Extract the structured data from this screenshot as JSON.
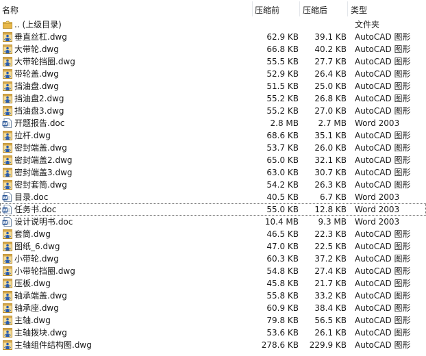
{
  "columns": {
    "name": "名称",
    "size": "压缩前",
    "packed": "压缩后",
    "type": "类型"
  },
  "parent": {
    "name": ".. (上级目录)",
    "type": "文件夹",
    "icon": "folder-icon"
  },
  "files": [
    {
      "name": "垂直丝杠.dwg",
      "size": "62.9 KB",
      "packed": "39.1 KB",
      "type": "AutoCAD 图形",
      "icon": "dwg-file-icon"
    },
    {
      "name": "大带轮.dwg",
      "size": "66.8 KB",
      "packed": "40.2 KB",
      "type": "AutoCAD 图形",
      "icon": "dwg-file-icon"
    },
    {
      "name": "大带轮挡圈.dwg",
      "size": "55.5 KB",
      "packed": "27.7 KB",
      "type": "AutoCAD 图形",
      "icon": "dwg-file-icon"
    },
    {
      "name": "带轮盖.dwg",
      "size": "52.9 KB",
      "packed": "26.4 KB",
      "type": "AutoCAD 图形",
      "icon": "dwg-file-icon"
    },
    {
      "name": "挡油盘.dwg",
      "size": "51.5 KB",
      "packed": "25.0 KB",
      "type": "AutoCAD 图形",
      "icon": "dwg-file-icon"
    },
    {
      "name": "挡油盘2.dwg",
      "size": "55.2 KB",
      "packed": "26.8 KB",
      "type": "AutoCAD 图形",
      "icon": "dwg-file-icon"
    },
    {
      "name": "挡油盘3.dwg",
      "size": "55.2 KB",
      "packed": "27.0 KB",
      "type": "AutoCAD 图形",
      "icon": "dwg-file-icon"
    },
    {
      "name": "开题报告.doc",
      "size": "2.8 MB",
      "packed": "2.7 MB",
      "type": "Word 2003",
      "icon": "word-file-icon"
    },
    {
      "name": "拉杆.dwg",
      "size": "68.6 KB",
      "packed": "35.1 KB",
      "type": "AutoCAD 图形",
      "icon": "dwg-file-icon"
    },
    {
      "name": "密封端盖.dwg",
      "size": "53.7 KB",
      "packed": "26.0 KB",
      "type": "AutoCAD 图形",
      "icon": "dwg-file-icon"
    },
    {
      "name": "密封端盖2.dwg",
      "size": "65.0 KB",
      "packed": "32.1 KB",
      "type": "AutoCAD 图形",
      "icon": "dwg-file-icon"
    },
    {
      "name": "密封端盖3.dwg",
      "size": "63.0 KB",
      "packed": "30.7 KB",
      "type": "AutoCAD 图形",
      "icon": "dwg-file-icon"
    },
    {
      "name": "密封套筒.dwg",
      "size": "54.2 KB",
      "packed": "26.3 KB",
      "type": "AutoCAD 图形",
      "icon": "dwg-file-icon"
    },
    {
      "name": "目录.doc",
      "size": "40.5 KB",
      "packed": "6.7 KB",
      "type": "Word 2003",
      "icon": "word-file-icon"
    },
    {
      "name": "任务书.doc",
      "size": "55.0 KB",
      "packed": "12.8 KB",
      "type": "Word 2003",
      "icon": "word-file-icon",
      "selected": true
    },
    {
      "name": "设计说明书.doc",
      "size": "10.4 MB",
      "packed": "9.3 MB",
      "type": "Word 2003",
      "icon": "word-file-icon"
    },
    {
      "name": "套筒.dwg",
      "size": "46.5 KB",
      "packed": "22.3 KB",
      "type": "AutoCAD 图形",
      "icon": "dwg-file-icon"
    },
    {
      "name": "图纸_6.dwg",
      "size": "47.0 KB",
      "packed": "22.5 KB",
      "type": "AutoCAD 图形",
      "icon": "dwg-file-icon"
    },
    {
      "name": "小带轮.dwg",
      "size": "60.3 KB",
      "packed": "37.2 KB",
      "type": "AutoCAD 图形",
      "icon": "dwg-file-icon"
    },
    {
      "name": "小带轮挡圈.dwg",
      "size": "54.8 KB",
      "packed": "27.4 KB",
      "type": "AutoCAD 图形",
      "icon": "dwg-file-icon"
    },
    {
      "name": "压板.dwg",
      "size": "45.8 KB",
      "packed": "21.7 KB",
      "type": "AutoCAD 图形",
      "icon": "dwg-file-icon"
    },
    {
      "name": "轴承端盖.dwg",
      "size": "55.8 KB",
      "packed": "33.2 KB",
      "type": "AutoCAD 图形",
      "icon": "dwg-file-icon"
    },
    {
      "name": "轴承座.dwg",
      "size": "60.9 KB",
      "packed": "38.4 KB",
      "type": "AutoCAD 图形",
      "icon": "dwg-file-icon"
    },
    {
      "name": "主轴.dwg",
      "size": "79.8 KB",
      "packed": "56.5 KB",
      "type": "AutoCAD 图形",
      "icon": "dwg-file-icon"
    },
    {
      "name": "主轴拨块.dwg",
      "size": "53.6 KB",
      "packed": "26.1 KB",
      "type": "AutoCAD 图形",
      "icon": "dwg-file-icon"
    },
    {
      "name": "主轴组件结构图.dwg",
      "size": "278.6 KB",
      "packed": "229.9 KB",
      "type": "AutoCAD 图形",
      "icon": "dwg-file-icon"
    }
  ],
  "colors": {
    "folder": "#e8b84a",
    "dwg_box": "#d4a64a",
    "dwg_figure": "#2a5db0",
    "word_blue": "#2b5797"
  }
}
